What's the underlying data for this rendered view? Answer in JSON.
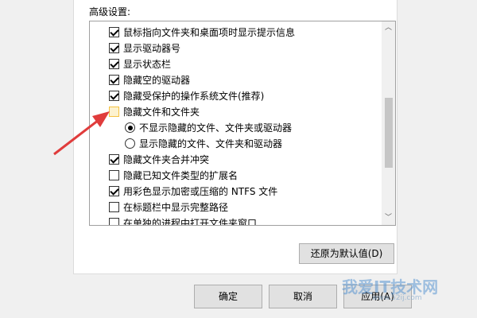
{
  "section_label": "高级设置:",
  "items": [
    {
      "kind": "checkbox",
      "checked": true,
      "label": "鼠标指向文件夹和桌面项时显示提示信息"
    },
    {
      "kind": "checkbox",
      "checked": true,
      "label": "显示驱动器号"
    },
    {
      "kind": "checkbox",
      "checked": true,
      "label": "显示状态栏"
    },
    {
      "kind": "checkbox",
      "checked": true,
      "label": "隐藏空的驱动器"
    },
    {
      "kind": "checkbox",
      "checked": true,
      "label": "隐藏受保护的操作系统文件(推荐)"
    },
    {
      "kind": "group",
      "highlight": true,
      "label": "隐藏文件和文件夹"
    },
    {
      "kind": "radio",
      "selected": true,
      "label": "不显示隐藏的文件、文件夹或驱动器"
    },
    {
      "kind": "radio",
      "selected": false,
      "label": "显示隐藏的文件、文件夹和驱动器"
    },
    {
      "kind": "checkbox",
      "checked": true,
      "label": "隐藏文件夹合并冲突"
    },
    {
      "kind": "checkbox",
      "checked": false,
      "label": "隐藏已知文件类型的扩展名"
    },
    {
      "kind": "checkbox",
      "checked": true,
      "label": "用彩色显示加密或压缩的 NTFS 文件"
    },
    {
      "kind": "checkbox",
      "checked": false,
      "label": "在标题栏中显示完整路径"
    },
    {
      "kind": "checkbox",
      "checked": false,
      "label": "在单独的进程中打开文件夹窗口"
    }
  ],
  "restore_defaults_label": "还原为默认值(D)",
  "buttons": {
    "ok": "确定",
    "cancel": "取消",
    "apply": "应用(A)"
  },
  "watermark": {
    "main": "我爱IT技术网",
    "sub": "www.52ij.com"
  },
  "colors": {
    "arrow": "#e03c3c",
    "highlight_box": "#f5c242"
  }
}
